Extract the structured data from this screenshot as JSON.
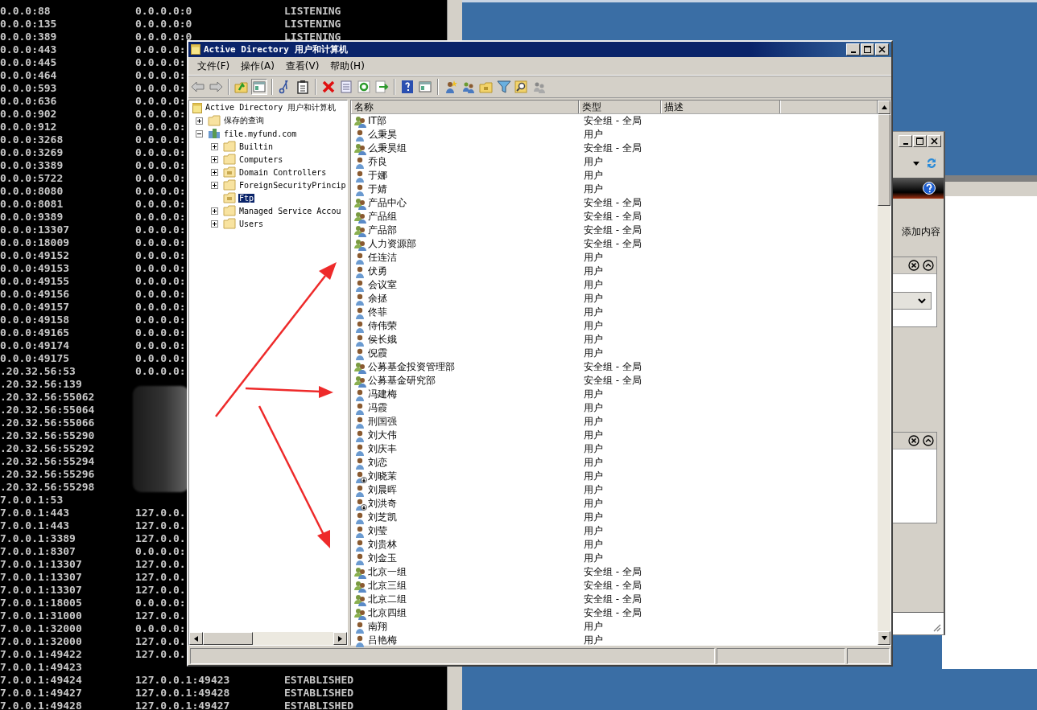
{
  "console": {
    "rows": [
      {
        "local": "0.0.0:88",
        "foreign": "0.0.0.0:0",
        "state": "LISTENING"
      },
      {
        "local": "0.0.0:135",
        "foreign": "0.0.0.0:0",
        "state": "LISTENING"
      },
      {
        "local": "0.0.0:389",
        "foreign": "0.0.0.0:0",
        "state": "LISTENING"
      },
      {
        "local": "0.0.0:443",
        "foreign": "0.0.0.0:"
      },
      {
        "local": "0.0.0:445",
        "foreign": "0.0.0.0:"
      },
      {
        "local": "0.0.0:464",
        "foreign": "0.0.0.0:"
      },
      {
        "local": "0.0.0:593",
        "foreign": "0.0.0.0:"
      },
      {
        "local": "0.0.0:636",
        "foreign": "0.0.0.0:"
      },
      {
        "local": "0.0.0:902",
        "foreign": "0.0.0.0:"
      },
      {
        "local": "0.0.0:912",
        "foreign": "0.0.0.0:"
      },
      {
        "local": "0.0.0:3268",
        "foreign": "0.0.0.0:"
      },
      {
        "local": "0.0.0:3269",
        "foreign": "0.0.0.0:"
      },
      {
        "local": "0.0.0:3389",
        "foreign": "0.0.0.0:"
      },
      {
        "local": "0.0.0:5722",
        "foreign": "0.0.0.0:"
      },
      {
        "local": "0.0.0:8080",
        "foreign": "0.0.0.0:"
      },
      {
        "local": "0.0.0:8081",
        "foreign": "0.0.0.0:"
      },
      {
        "local": "0.0.0:9389",
        "foreign": "0.0.0.0:"
      },
      {
        "local": "0.0.0:13307",
        "foreign": "0.0.0.0:"
      },
      {
        "local": "0.0.0:18009",
        "foreign": "0.0.0.0:"
      },
      {
        "local": "0.0.0:49152",
        "foreign": "0.0.0.0:"
      },
      {
        "local": "0.0.0:49153",
        "foreign": "0.0.0.0:"
      },
      {
        "local": "0.0.0:49155",
        "foreign": "0.0.0.0:"
      },
      {
        "local": "0.0.0:49156",
        "foreign": "0.0.0.0:"
      },
      {
        "local": "0.0.0:49157",
        "foreign": "0.0.0.0:"
      },
      {
        "local": "0.0.0:49158",
        "foreign": "0.0.0.0:"
      },
      {
        "local": "0.0.0:49165",
        "foreign": "0.0.0.0:"
      },
      {
        "local": "0.0.0:49174",
        "foreign": "0.0.0.0:"
      },
      {
        "local": "0.0.0:49175",
        "foreign": "0.0.0.0:"
      },
      {
        "local": ".20.32.56:53",
        "foreign": "0.0.0.0:"
      },
      {
        "local": ".20.32.56:139"
      },
      {
        "local": ".20.32.56:55062"
      },
      {
        "local": ".20.32.56:55064"
      },
      {
        "local": ".20.32.56:55066"
      },
      {
        "local": ".20.32.56:55290"
      },
      {
        "local": ".20.32.56:55292"
      },
      {
        "local": ".20.32.56:55294"
      },
      {
        "local": ".20.32.56:55296"
      },
      {
        "local": ".20.32.56:55298"
      },
      {
        "local": "7.0.0.1:53"
      },
      {
        "local": "7.0.0.1:443",
        "foreign": "127.0.0."
      },
      {
        "local": "7.0.0.1:443",
        "foreign": "127.0.0."
      },
      {
        "local": "7.0.0.1:3389",
        "foreign": "127.0.0."
      },
      {
        "local": "7.0.0.1:8307",
        "foreign": "0.0.0.0:"
      },
      {
        "local": "7.0.0.1:13307",
        "foreign": "127.0.0."
      },
      {
        "local": "7.0.0.1:13307",
        "foreign": "127.0.0."
      },
      {
        "local": "7.0.0.1:13307",
        "foreign": "127.0.0."
      },
      {
        "local": "7.0.0.1:18005",
        "foreign": "0.0.0.0:"
      },
      {
        "local": "7.0.0.1:31000",
        "foreign": "127.0.0."
      },
      {
        "local": "7.0.0.1:32000",
        "foreign": "0.0.0.0:"
      },
      {
        "local": "7.0.0.1:32000",
        "foreign": "127.0.0."
      },
      {
        "local": "7.0.0.1:49422",
        "foreign": "127.0.0."
      },
      {
        "local": "7.0.0.1:49423"
      },
      {
        "local": "7.0.0.1:49424",
        "foreign": "127.0.0.1:49423",
        "state": "ESTABLISHED"
      },
      {
        "local": "7.0.0.1:49427",
        "foreign": "127.0.0.1:49428",
        "state": "ESTABLISHED"
      },
      {
        "local": "7.0.0.1:49428",
        "foreign": "127.0.0.1:49427",
        "state": "ESTABLISHED"
      }
    ]
  },
  "back_window": {
    "label": "添加内容"
  },
  "window": {
    "title": "Active Directory 用户和计算机",
    "menu": [
      "文件(F)",
      "操作(A)",
      "查看(V)",
      "帮助(H)"
    ],
    "tree": {
      "label": "Active Directory 用户和计算机",
      "children": [
        {
          "label": "保存的查询",
          "kind": "folder",
          "expanded": false,
          "selected": false
        },
        {
          "label": "file.myfund.com",
          "kind": "domain",
          "expanded": true,
          "selected": false,
          "children": [
            {
              "label": "Builtin",
              "kind": "folder",
              "expandable": true,
              "selected": false
            },
            {
              "label": "Computers",
              "kind": "folder",
              "expandable": true,
              "selected": false
            },
            {
              "label": "Domain Controllers",
              "kind": "ou",
              "expandable": true,
              "selected": false
            },
            {
              "label": "ForeignSecurityPrincip",
              "kind": "folder",
              "expandable": true,
              "selected": false
            },
            {
              "label": "Ftp",
              "kind": "ou",
              "expandable": false,
              "selected": true
            },
            {
              "label": "Managed Service Accou",
              "kind": "folder",
              "expandable": true,
              "selected": false
            },
            {
              "label": "Users",
              "kind": "folder",
              "expandable": true,
              "selected": false
            }
          ]
        }
      ]
    },
    "columns": [
      "名称",
      "类型",
      "描述"
    ],
    "rows": [
      {
        "name": "IT部",
        "type": "安全组 - 全局",
        "kind": "group",
        "disabled": false
      },
      {
        "name": "么秉昊",
        "type": "用户",
        "kind": "user",
        "disabled": false
      },
      {
        "name": "么秉昊组",
        "type": "安全组 - 全局",
        "kind": "group",
        "disabled": false
      },
      {
        "name": "乔良",
        "type": "用户",
        "kind": "user",
        "disabled": false
      },
      {
        "name": "于娜",
        "type": "用户",
        "kind": "user",
        "disabled": false
      },
      {
        "name": "于婧",
        "type": "用户",
        "kind": "user",
        "disabled": false
      },
      {
        "name": "产品中心",
        "type": "安全组 - 全局",
        "kind": "group",
        "disabled": false
      },
      {
        "name": "产品组",
        "type": "安全组 - 全局",
        "kind": "group",
        "disabled": false
      },
      {
        "name": "产品部",
        "type": "安全组 - 全局",
        "kind": "group",
        "disabled": false
      },
      {
        "name": "人力资源部",
        "type": "安全组 - 全局",
        "kind": "group",
        "disabled": false
      },
      {
        "name": "任连洁",
        "type": "用户",
        "kind": "user",
        "disabled": false
      },
      {
        "name": "伏勇",
        "type": "用户",
        "kind": "user",
        "disabled": false
      },
      {
        "name": "会议室",
        "type": "用户",
        "kind": "user",
        "disabled": false
      },
      {
        "name": "余拯",
        "type": "用户",
        "kind": "user",
        "disabled": false
      },
      {
        "name": "佟菲",
        "type": "用户",
        "kind": "user",
        "disabled": false
      },
      {
        "name": "侍伟荣",
        "type": "用户",
        "kind": "user",
        "disabled": false
      },
      {
        "name": "侯长娥",
        "type": "用户",
        "kind": "user",
        "disabled": false
      },
      {
        "name": "倪霞",
        "type": "用户",
        "kind": "user",
        "disabled": false
      },
      {
        "name": "公募基金投资管理部",
        "type": "安全组 - 全局",
        "kind": "group",
        "disabled": false
      },
      {
        "name": "公募基金研究部",
        "type": "安全组 - 全局",
        "kind": "group",
        "disabled": false
      },
      {
        "name": "冯建梅",
        "type": "用户",
        "kind": "user",
        "disabled": false
      },
      {
        "name": "冯霞",
        "type": "用户",
        "kind": "user",
        "disabled": false
      },
      {
        "name": "刑国强",
        "type": "用户",
        "kind": "user",
        "disabled": false
      },
      {
        "name": "刘大伟",
        "type": "用户",
        "kind": "user",
        "disabled": false
      },
      {
        "name": "刘庆丰",
        "type": "用户",
        "kind": "user",
        "disabled": false
      },
      {
        "name": "刘恋",
        "type": "用户",
        "kind": "user",
        "disabled": false
      },
      {
        "name": "刘晓茉",
        "type": "用户",
        "kind": "user",
        "disabled": true
      },
      {
        "name": "刘晨晖",
        "type": "用户",
        "kind": "user",
        "disabled": false
      },
      {
        "name": "刘洪奇",
        "type": "用户",
        "kind": "user",
        "disabled": true
      },
      {
        "name": "刘芝凯",
        "type": "用户",
        "kind": "user",
        "disabled": false
      },
      {
        "name": "刘莹",
        "type": "用户",
        "kind": "user",
        "disabled": false
      },
      {
        "name": "刘贵林",
        "type": "用户",
        "kind": "user",
        "disabled": false
      },
      {
        "name": "刘金玉",
        "type": "用户",
        "kind": "user",
        "disabled": false
      },
      {
        "name": "北京一组",
        "type": "安全组 - 全局",
        "kind": "group",
        "disabled": false
      },
      {
        "name": "北京三组",
        "type": "安全组 - 全局",
        "kind": "group",
        "disabled": false
      },
      {
        "name": "北京二组",
        "type": "安全组 - 全局",
        "kind": "group",
        "disabled": false
      },
      {
        "name": "北京四组",
        "type": "安全组 - 全局",
        "kind": "group",
        "disabled": false
      },
      {
        "name": "南翔",
        "type": "用户",
        "kind": "user",
        "disabled": false
      },
      {
        "name": "吕艳梅",
        "type": "用户",
        "kind": "user",
        "disabled": false
      }
    ]
  }
}
